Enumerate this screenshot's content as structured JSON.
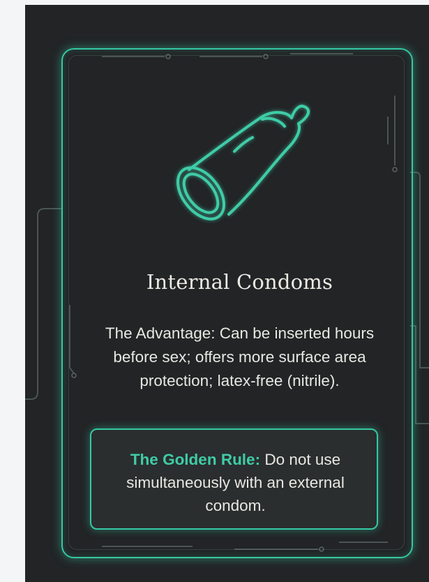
{
  "card": {
    "icon": "internal-condom-icon",
    "title": "Internal Condoms",
    "advantage_text": "The Advantage: Can be inserted hours before sex; offers more surface area protection; latex-free (nitrile).",
    "golden_rule": {
      "label": "The Golden Rule:",
      "text": "Do not use simultaneously with an external condom."
    }
  },
  "colors": {
    "background": "#222426",
    "accent": "#35c8a2",
    "text": "#e8e7e2"
  }
}
